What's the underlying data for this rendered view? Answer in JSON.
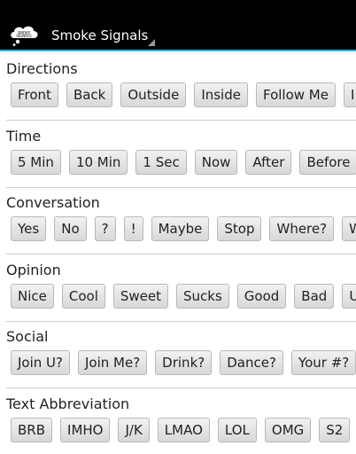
{
  "app": {
    "title": "Smoke Signals",
    "icon": "smoke-signals-cloud-icon",
    "icon_text": "SMOKE SIGNALS"
  },
  "colors": {
    "action_bar": "#000000",
    "accent": "#33b5e5",
    "button_border": "#b8b8b8"
  },
  "sections": [
    {
      "title": "Directions",
      "buttons": [
        "Front",
        "Back",
        "Outside",
        "Inside",
        "Follow Me",
        "I"
      ]
    },
    {
      "title": "Time",
      "buttons": [
        "5 Min",
        "10 Min",
        "1 Sec",
        "Now",
        "After",
        "Before"
      ]
    },
    {
      "title": "Conversation",
      "buttons": [
        "Yes",
        "No",
        "?",
        "!",
        "Maybe",
        "Stop",
        "Where?",
        "W"
      ]
    },
    {
      "title": "Opinion",
      "buttons": [
        "Nice",
        "Cool",
        "Sweet",
        "Sucks",
        "Good",
        "Bad",
        "U"
      ]
    },
    {
      "title": "Social",
      "buttons": [
        "Join U?",
        "Join Me?",
        "Drink?",
        "Dance?",
        "Your #?",
        "I"
      ]
    },
    {
      "title": "Text Abbreviation",
      "buttons": [
        "BRB",
        "IMHO",
        "J/K",
        "LMAO",
        "LOL",
        "OMG",
        "S2"
      ]
    }
  ]
}
